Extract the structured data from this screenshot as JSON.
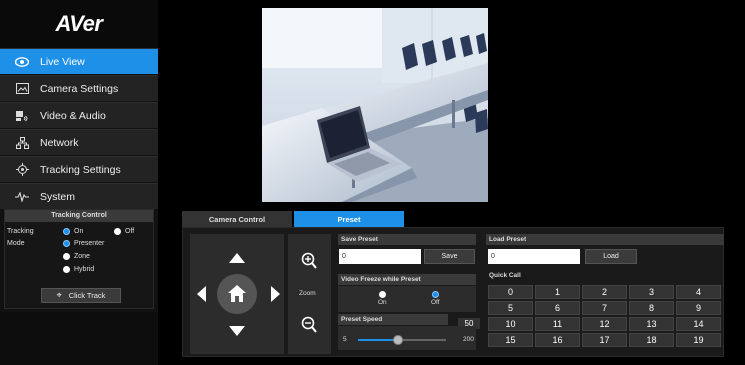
{
  "sidebar": {
    "logo": "AVer",
    "items": [
      {
        "label": "Live View",
        "icon": "eye-icon",
        "active": true
      },
      {
        "label": "Camera Settings",
        "icon": "image-icon",
        "active": false
      },
      {
        "label": "Video & Audio",
        "icon": "video-audio-icon",
        "active": false
      },
      {
        "label": "Network",
        "icon": "network-icon",
        "active": false
      },
      {
        "label": "Tracking Settings",
        "icon": "target-icon",
        "active": false
      },
      {
        "label": "System",
        "icon": "pulse-icon",
        "active": false
      }
    ],
    "tracking_control": {
      "title": "Tracking Control",
      "tracking_label": "Tracking",
      "mode_label": "Mode",
      "on_label": "On",
      "off_label": "Off",
      "presenter_label": "Presenter",
      "zone_label": "Zone",
      "hybrid_label": "Hybrid",
      "click_track_label": "Click Track"
    }
  },
  "tabs": {
    "camera_control": "Camera Control",
    "preset": "Preset",
    "active": "Preset"
  },
  "controls": {
    "zoom_label": "Zoom"
  },
  "save_preset": {
    "title": "Save Preset",
    "value": "0",
    "button": "Save"
  },
  "video_freeze": {
    "title": "Video Freeze while Preset",
    "on_label": "On",
    "off_label": "Off",
    "selected": "Off"
  },
  "preset_speed": {
    "title": "Preset Speed",
    "value": "50",
    "min": "5",
    "max": "200"
  },
  "load_preset": {
    "title": "Load Preset",
    "value": "0",
    "button": "Load",
    "quick_call_label": "Quick Call",
    "quick_call": [
      "0",
      "1",
      "2",
      "3",
      "4",
      "5",
      "6",
      "7",
      "8",
      "9",
      "10",
      "11",
      "12",
      "13",
      "14",
      "15",
      "16",
      "17",
      "18",
      "19"
    ]
  },
  "colors": {
    "accent": "#1e90e8",
    "sidebar_bg": "#111111",
    "panel_bg": "#1a1a1a"
  }
}
